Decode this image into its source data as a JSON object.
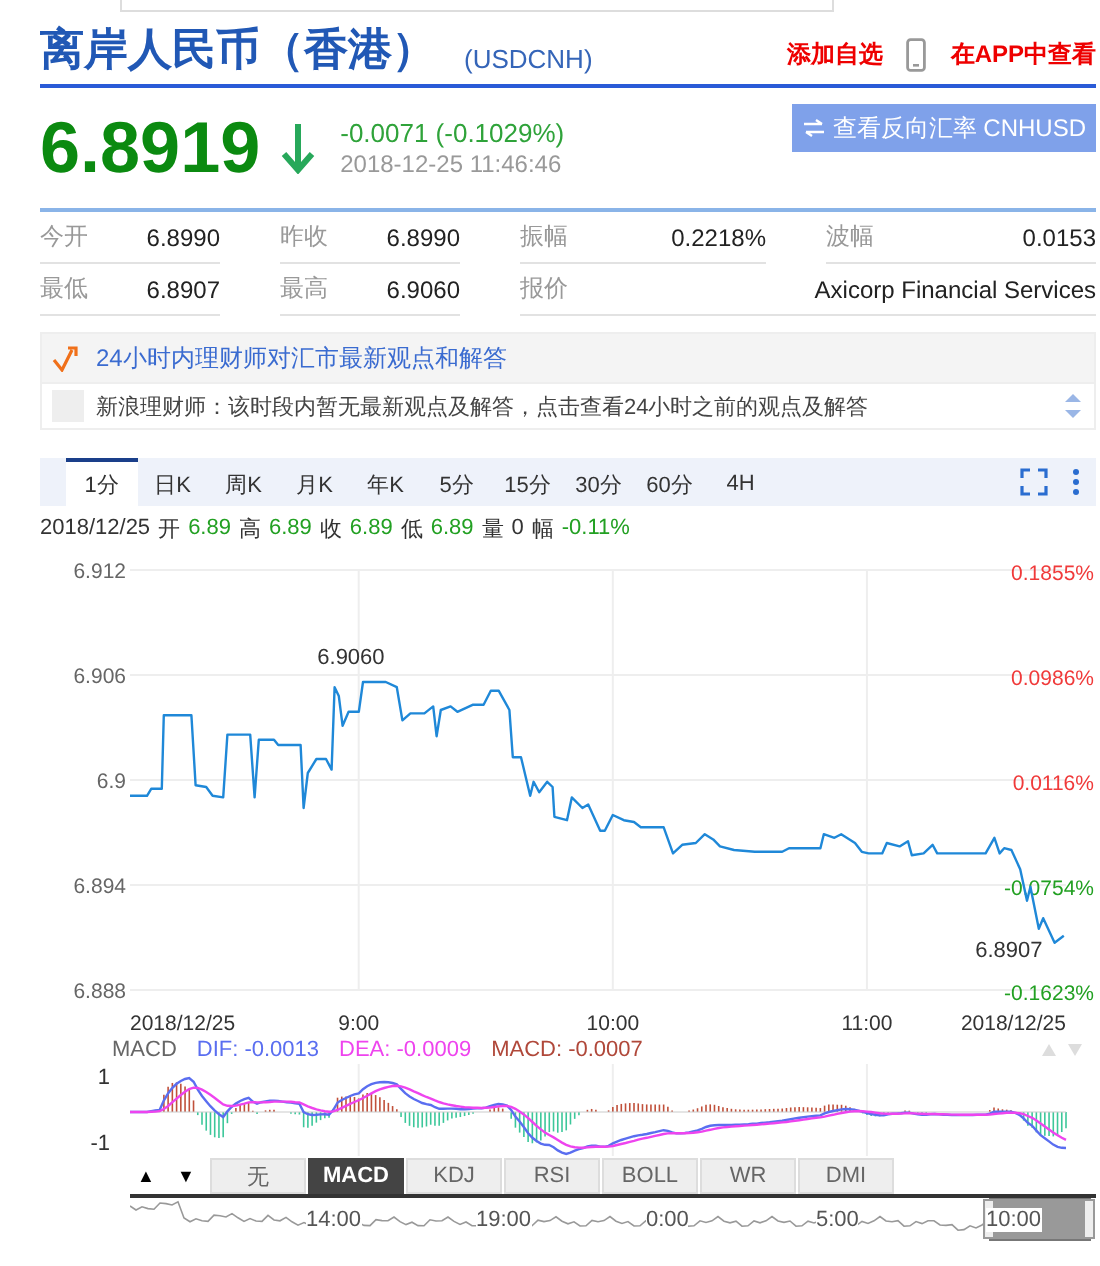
{
  "header": {
    "title": "离岸人民币（香港）",
    "code": "(USDCNH)",
    "actions": [
      {
        "kind": "text",
        "label": "添加自选"
      },
      {
        "kind": "app",
        "label": "在APP中查看"
      }
    ]
  },
  "quote": {
    "price": "6.8919",
    "change": "-0.0071 (-0.1029%)",
    "time": "2018-12-25 11:46:46",
    "reverse_button": "查看反向汇率 CNHUSD"
  },
  "stats": [
    [
      {
        "label": "今开",
        "value": "6.8990"
      },
      {
        "label": "昨收",
        "value": "6.8990"
      },
      {
        "label": "振幅",
        "value": "0.2218%"
      },
      {
        "label": "波幅",
        "value": "0.0153"
      }
    ],
    [
      {
        "label": "最低",
        "value": "6.8907"
      },
      {
        "label": "最高",
        "value": "6.9060"
      },
      {
        "label": "报价",
        "value": "Axicorp Financial Services"
      }
    ]
  ],
  "news": {
    "heading": "24小时内理财师对汇市最新观点和解答",
    "message": "新浪理财师：该时段内暂无最新观点及解答，点击查看24小时之前的观点及解答"
  },
  "period_tabs": [
    {
      "label": "1分",
      "selected": true
    },
    {
      "label": "日K",
      "selected": false
    },
    {
      "label": "周K",
      "selected": false
    },
    {
      "label": "月K",
      "selected": false
    },
    {
      "label": "年K",
      "selected": false
    },
    {
      "label": "5分",
      "selected": false
    },
    {
      "label": "15分",
      "selected": false
    },
    {
      "label": "30分",
      "selected": false
    },
    {
      "label": "60分",
      "selected": false
    },
    {
      "label": "4H",
      "selected": false
    }
  ],
  "bar_info": {
    "date": "2018/12/25",
    "items": [
      {
        "label": "开",
        "value": "6.89",
        "color": "#22a022"
      },
      {
        "label": "高",
        "value": "6.89",
        "color": "#22a022"
      },
      {
        "label": "收",
        "value": "6.89",
        "color": "#22a022"
      },
      {
        "label": "低",
        "value": "6.89",
        "color": "#22a022"
      },
      {
        "label": "量",
        "value": "0",
        "color": "#333333"
      },
      {
        "label": "幅",
        "value": "-0.11%",
        "color": "#22a022"
      }
    ]
  },
  "price_chart": {
    "chart_data": {
      "type": "line",
      "grid": true,
      "xlim": [
        486,
        707
      ],
      "ylim": [
        6.888,
        6.912
      ],
      "yticks": [
        6.888,
        6.894,
        6.9,
        6.906,
        6.912
      ],
      "xticks": [
        {
          "value": 486,
          "label": "2018/12/25"
        },
        {
          "value": 540,
          "label": "9:00"
        },
        {
          "value": 600,
          "label": "10:00"
        },
        {
          "value": 660,
          "label": "11:00"
        },
        {
          "value": 707,
          "label": "2018/12/25"
        }
      ],
      "x": [
        486,
        490,
        491,
        493.5,
        494,
        500.5,
        501.5,
        504,
        505.5,
        508,
        509,
        514.4,
        515.4,
        516.4,
        520,
        521,
        526.3,
        527,
        528,
        530,
        532.3,
        533.6,
        534.3,
        535.3,
        536.2,
        537.6,
        540,
        541,
        546.4,
        549,
        550.3,
        552.2,
        555.5,
        557.6,
        558.4,
        559.4,
        561.7,
        563.3,
        566.9,
        569.5,
        571.2,
        573.1,
        575.6,
        576.4,
        578.3,
        580.5,
        581.3,
        582.6,
        584.5,
        585.8,
        586.2,
        589.2,
        590.3,
        592.8,
        594.2,
        597,
        598.1,
        600,
        602.6,
        605,
        606.6,
        612,
        614.2,
        616.4,
        619.6,
        621.7,
        623.7,
        625.3,
        628.6,
        633.5,
        640,
        641.6,
        649,
        649.8,
        652.3,
        653.9,
        657.2,
        658.8,
        660.4,
        663.6,
        664.7,
        667.7,
        669.7,
        670.6,
        673.4,
        675.5,
        676.6,
        688,
        690.1,
        691.3,
        692.4,
        694.1,
        696.2,
        697.8,
        698.6,
        700.6,
        701.6,
        704.3,
        706.5
      ],
      "series": [
        {
          "color": "#1f88d8",
          "values": [
            6.8991,
            6.8991,
            6.8995,
            6.8995,
            6.9037,
            6.9037,
            6.8997,
            6.8996,
            6.8991,
            6.899,
            6.9026,
            6.9026,
            6.899,
            6.9023,
            6.9023,
            6.902,
            6.902,
            6.8984,
            6.9004,
            6.9012,
            6.9012,
            6.9006,
            6.9053,
            6.9048,
            6.9031,
            6.9039,
            6.9039,
            6.9056,
            6.9056,
            6.9053,
            6.9034,
            6.9038,
            6.9038,
            6.9042,
            6.9025,
            6.904,
            6.9042,
            6.9039,
            6.9043,
            6.9043,
            6.9051,
            6.9051,
            6.904,
            6.9013,
            6.9013,
            6.8991,
            6.8999,
            6.8993,
            6.8999,
            6.8996,
            6.8979,
            6.8977,
            6.899,
            6.8984,
            6.8986,
            6.8971,
            6.8971,
            6.898,
            6.8977,
            6.8976,
            6.8973,
            6.8973,
            6.8958,
            6.8963,
            6.8964,
            6.8969,
            6.8966,
            6.8962,
            6.896,
            6.8959,
            6.8959,
            6.8961,
            6.8961,
            6.8969,
            6.8967,
            6.8969,
            6.8964,
            6.8959,
            6.8958,
            6.8958,
            6.8964,
            6.8962,
            6.8965,
            6.8957,
            6.8958,
            6.8963,
            6.8958,
            6.8958,
            6.8967,
            6.8958,
            6.8961,
            6.896,
            6.8949,
            6.8931,
            6.8939,
            6.8915,
            6.8921,
            6.8907,
            6.8911
          ]
        }
      ],
      "annotations": [
        {
          "x": 541,
          "y": 6.9056,
          "text": "6.9060"
        },
        {
          "x": 704.3,
          "y": 6.8907,
          "text": "6.8907"
        }
      ]
    },
    "percent_labels": [
      {
        "label": "0.1855%",
        "color": "#f03a3a"
      },
      {
        "label": "0.0986%",
        "color": "#f03a3a"
      },
      {
        "label": "0.0116%",
        "color": "#f03a3a"
      },
      {
        "label": "-0.0754%",
        "color": "#22a022"
      },
      {
        "label": "-0.1623%",
        "color": "#22a022"
      }
    ]
  },
  "indicator": {
    "legend": [
      {
        "label": "MACD",
        "color": "#666666"
      },
      {
        "label": "DIF: -0.0013",
        "color": "#5a6ef0"
      },
      {
        "label": "DEA: -0.0009",
        "color": "#ee44ee"
      },
      {
        "label": "MACD: -0.0007",
        "color": "#b0483a"
      }
    ],
    "axis_labels": [
      "1",
      "-1"
    ],
    "scroll_buttons": [
      "▲",
      "▼"
    ],
    "tabs": [
      {
        "label": "无",
        "selected": false
      },
      {
        "label": "MACD",
        "selected": true
      },
      {
        "label": "KDJ",
        "selected": false
      },
      {
        "label": "RSI",
        "selected": false
      },
      {
        "label": "BOLL",
        "selected": false
      },
      {
        "label": "WR",
        "selected": false
      },
      {
        "label": "DMI",
        "selected": false
      }
    ]
  },
  "navigator": {
    "time_labels": [
      "14:00",
      "19:00",
      "0:00",
      "5:00",
      "10:00"
    ]
  }
}
